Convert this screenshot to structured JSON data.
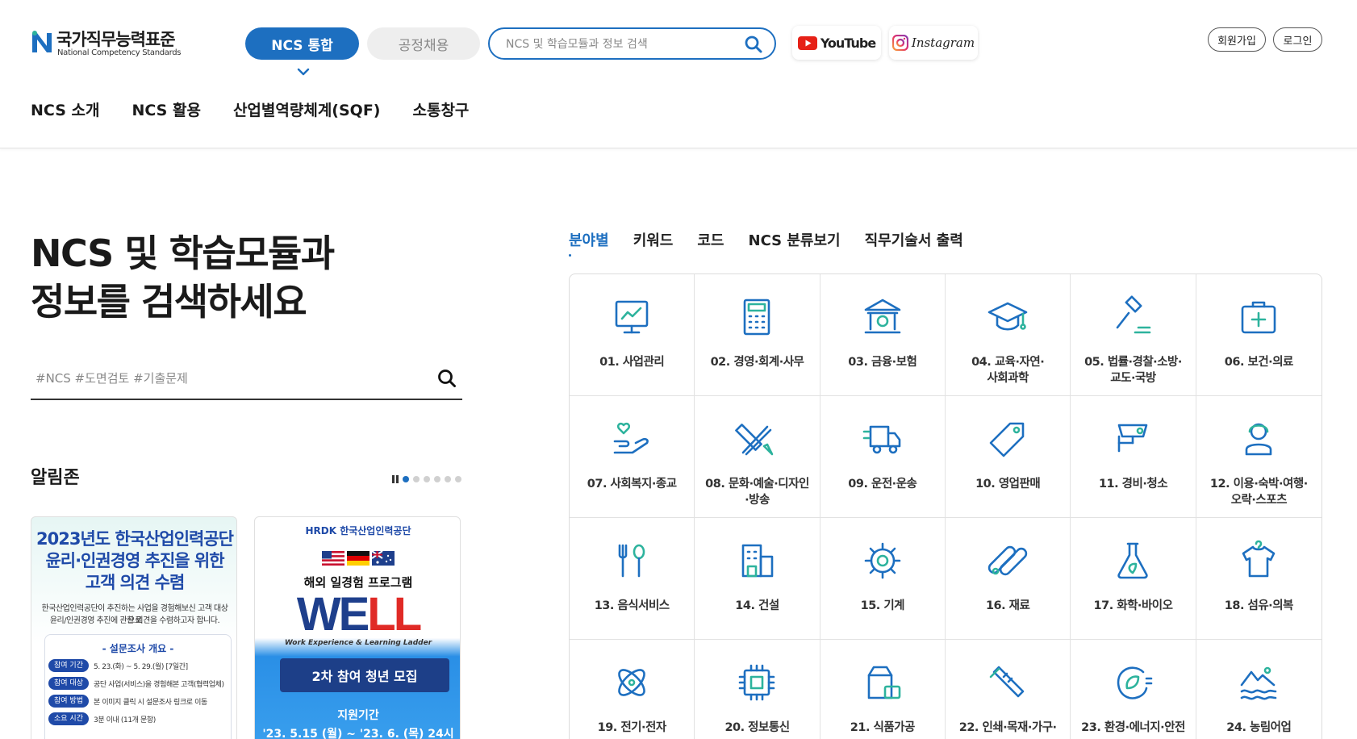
{
  "brand": {
    "name_ko": "국가직무능력표준",
    "name_en": "National Competency Standards",
    "colors": {
      "primary": "#1d6fc0",
      "accent": "#2db39d"
    }
  },
  "top": {
    "tab_ncs": "NCS 통합",
    "tab_hire": "공정채용",
    "search_placeholder": "NCS 및 학습모듈과 정보 검색",
    "youtube": "YouTube",
    "instagram": "Instagram",
    "join": "회원가입",
    "login": "로그인"
  },
  "gnb": [
    "NCS 소개",
    "NCS 활용",
    "산업별역량체계(SQF)",
    "소통창구"
  ],
  "hero": {
    "line1": "NCS 및 학습모듈과",
    "line2": "정보를 검색하세요"
  },
  "main_search": {
    "placeholder": "#NCS #도면검토 #기출문제"
  },
  "notice": {
    "title": "알림존",
    "card1": {
      "line1": "2023년도 한국산업인력공단",
      "line2": "윤리·인권경영 추진을 위한",
      "line3": "고객 의견 수렴",
      "desc1": "한국산업인력공단이 추진하는 사업을 경험해보신 고객 대상으로",
      "desc2": "윤리/인권경영 추진에 관한 의견을 수렴하고자 합니다.",
      "survey_title": "- 설문조사 개요 -",
      "rows": [
        {
          "tag": "참여 기간",
          "val": "5. 23.(화) ~ 5. 29.(월) [7일간]"
        },
        {
          "tag": "참여 대상",
          "val": "공단 사업(서비스)을 경험해본 고객(협력업체)"
        },
        {
          "tag": "참여 방법",
          "val": "본 이미지 클릭 시 설문조사 링크로 이동"
        },
        {
          "tag": "소요 시간",
          "val": "3분 이내 (11개 문항)"
        }
      ]
    },
    "card2": {
      "brand": "HRDK 한국산업인력공단",
      "program": "해외 일경험 프로그램",
      "well_a": "WE",
      "well_b": "LL",
      "subtitle": "Work Experience & Learning Ladder",
      "banner": "2차 참여 청년 모집",
      "period_title": "지원기간",
      "period": "'23. 5.15 (월) ~ '23. 6. (목) 24시"
    }
  },
  "tabs": [
    "분야별",
    "키워드",
    "코드",
    "NCS 분류보기",
    "직무기술서 출력"
  ],
  "categories": [
    {
      "label": "01. 사업관리",
      "icon": "presentation-chart-icon"
    },
    {
      "label": "02. 경영·회계·사무",
      "icon": "calculator-icon"
    },
    {
      "label": "03. 금융·보험",
      "icon": "bank-icon"
    },
    {
      "label": "04. 교육·자연·\n사회과학",
      "icon": "graduation-cap-icon"
    },
    {
      "label": "05. 법률·경찰·소방·\n교도·국방",
      "icon": "gavel-icon"
    },
    {
      "label": "06. 보건·의료",
      "icon": "medical-kit-icon"
    },
    {
      "label": "07. 사회복지·종교",
      "icon": "care-hand-icon"
    },
    {
      "label": "08. 문화·예술·디자인\n·방송",
      "icon": "design-tools-icon"
    },
    {
      "label": "09. 운전·운송",
      "icon": "truck-icon"
    },
    {
      "label": "10. 영업판매",
      "icon": "price-tag-icon"
    },
    {
      "label": "11. 경비·청소",
      "icon": "cctv-icon"
    },
    {
      "label": "12. 이용·숙박·여행·\n오락·스포츠",
      "icon": "service-person-icon"
    },
    {
      "label": "13. 음식서비스",
      "icon": "fork-spoon-icon"
    },
    {
      "label": "14. 건설",
      "icon": "building-icon"
    },
    {
      "label": "15. 기계",
      "icon": "gear-icon"
    },
    {
      "label": "16. 재료",
      "icon": "pipes-icon"
    },
    {
      "label": "17. 화학·바이오",
      "icon": "flask-icon"
    },
    {
      "label": "18. 섬유·의복",
      "icon": "shirt-icon"
    },
    {
      "label": "19. 전기·전자",
      "icon": "atom-icon"
    },
    {
      "label": "20. 정보통신",
      "icon": "chip-icon"
    },
    {
      "label": "21. 식품가공",
      "icon": "food-package-icon"
    },
    {
      "label": "22. 인쇄·목재·가구·",
      "icon": "saw-icon"
    },
    {
      "label": "23. 환경·에너지·안전",
      "icon": "eco-plug-icon"
    },
    {
      "label": "24. 농림어업",
      "icon": "landscape-icon"
    }
  ]
}
